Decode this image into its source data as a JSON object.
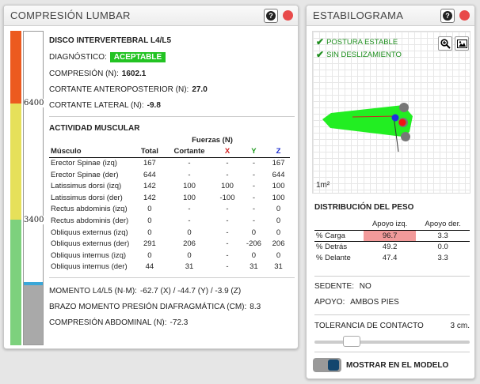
{
  "lumbar": {
    "title": "COMPRESIÓN LUMBAR",
    "gauge_labels": [
      "6400",
      "3400"
    ],
    "disc_title": "DISCO INTERVERTEBRAL L4/L5",
    "diag_label": "DIAGNÓSTICO:",
    "diag_value": "ACEPTABLE",
    "compression_label": "COMPRESIÓN (N):",
    "compression_value": "1602.1",
    "ap_label": "CORTANTE ANTEROPOSTERIOR (N):",
    "ap_value": "27.0",
    "lat_label": "CORTANTE LATERAL (N):",
    "lat_value": "-9.8",
    "muscle_title": "ACTIVIDAD MUSCULAR",
    "forces_header": "Fuerzas (N)",
    "columns": [
      "Músculo",
      "Total",
      "Cortante",
      "X",
      "Y",
      "Z"
    ],
    "rows": [
      [
        "Erector Spinae (izq)",
        "167",
        "-",
        "-",
        "-",
        "167"
      ],
      [
        "Erector Spinae (der)",
        "644",
        "-",
        "-",
        "-",
        "644"
      ],
      [
        "Latissimus dorsi (izq)",
        "142",
        "100",
        "100",
        "-",
        "100"
      ],
      [
        "Latissimus dorsi (der)",
        "142",
        "100",
        "-100",
        "-",
        "100"
      ],
      [
        "Rectus abdominis (izq)",
        "0",
        "-",
        "-",
        "-",
        "0"
      ],
      [
        "Rectus abdominis (der)",
        "0",
        "-",
        "-",
        "-",
        "0"
      ],
      [
        "Obliquus externus (izq)",
        "0",
        "0",
        "-",
        "0",
        "0"
      ],
      [
        "Obliquus externus (der)",
        "291",
        "206",
        "-",
        "-206",
        "206"
      ],
      [
        "Obliquus internus (izq)",
        "0",
        "0",
        "-",
        "0",
        "0"
      ],
      [
        "Obliquus internus (der)",
        "44",
        "31",
        "-",
        "31",
        "31"
      ]
    ],
    "moment_label": "MOMENTO L4/L5 (N·M):",
    "moment_value": "-62.7 (X) / -44.7 (Y) / -3.9 (Z)",
    "arm_label": "BRAZO MOMENTO PRESIÓN DIAFRAGMÁTICA (CM):",
    "arm_value": "8.3",
    "abd_label": "COMPRESIÓN ABDOMINAL (N):",
    "abd_value": "-72.3"
  },
  "estab": {
    "title": "ESTABILOGRAMA",
    "check1": "POSTURA ESTABLE",
    "check2": "SIN DESLIZAMIENTO",
    "area_label": "1m²",
    "dist_title": "DISTRIBUCIÓN DEL PESO",
    "dist_cols": [
      "",
      "Apoyo izq.",
      "Apoyo der."
    ],
    "dist_rows": [
      [
        "% Carga",
        "96.7",
        "3.3"
      ],
      [
        "% Detrás",
        "49.2",
        "0.0"
      ],
      [
        "% Delante",
        "47.4",
        "3.3"
      ]
    ],
    "sedente_label": "SEDENTE:",
    "sedente_value": "NO",
    "apoyo_label": "APOYO:",
    "apoyo_value": "AMBOS PIES",
    "tol_label": "TOLERANCIA DE CONTACTO",
    "tol_value": "3 cm.",
    "show_label": "MOSTRAR EN EL MODELO"
  },
  "icons": {
    "help": "?",
    "zoom": "zoom-icon",
    "image": "image-icon",
    "check": "✔"
  },
  "colors": {
    "gauge_red": "#ec5a1f",
    "gauge_yellow": "#e6e05a",
    "gauge_green": "#7dd17d",
    "diag_green": "#22c322",
    "support_polygon": "#22ee22",
    "load_pink": "#f29a9a"
  }
}
